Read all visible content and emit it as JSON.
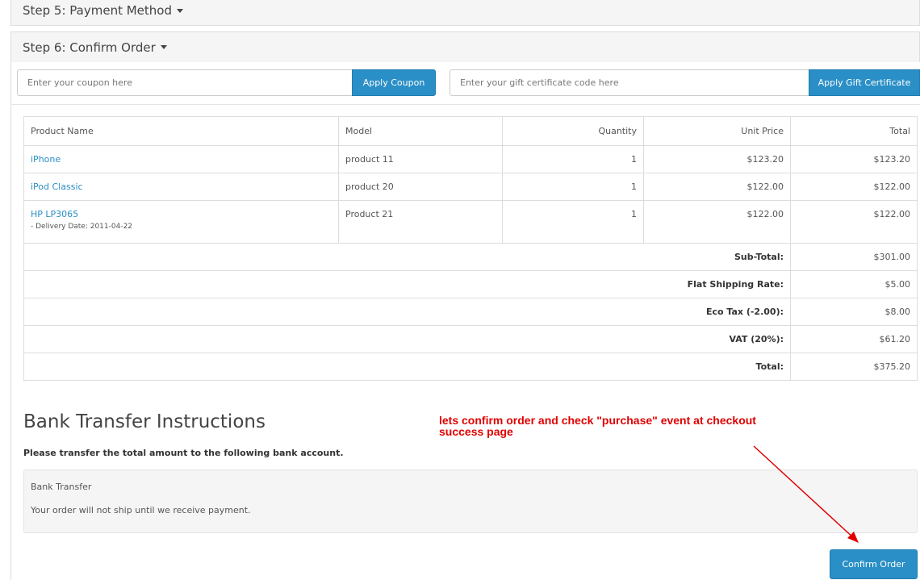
{
  "steps": {
    "step5": "Step 5: Payment Method",
    "step6": "Step 6: Confirm Order"
  },
  "coupon": {
    "placeholder": "Enter your coupon here",
    "button": "Apply Coupon"
  },
  "voucher": {
    "placeholder": "Enter your gift certificate code here",
    "button": "Apply Gift Certificate"
  },
  "table": {
    "headers": [
      "Product Name",
      "Model",
      "Quantity",
      "Unit Price",
      "Total"
    ],
    "rows": [
      {
        "name": "iPhone",
        "model": "product 11",
        "qty": "1",
        "price": "$123.20",
        "total": "$123.20"
      },
      {
        "name": "iPod Classic",
        "model": "product 20",
        "qty": "1",
        "price": "$122.00",
        "total": "$122.00"
      },
      {
        "name": "HP LP3065",
        "option": "- Delivery Date: 2011-04-22",
        "model": "Product 21",
        "qty": "1",
        "price": "$122.00",
        "total": "$122.00"
      }
    ],
    "totals": [
      {
        "label": "Sub-Total:",
        "value": "$301.00"
      },
      {
        "label": "Flat Shipping Rate:",
        "value": "$5.00"
      },
      {
        "label": "Eco Tax (-2.00):",
        "value": "$8.00"
      },
      {
        "label": "VAT (20%):",
        "value": "$61.20"
      },
      {
        "label": "Total:",
        "value": "$375.20"
      }
    ]
  },
  "bank": {
    "title": "Bank Transfer Instructions",
    "subtitle": "Please transfer the total amount to the following bank account.",
    "method": "Bank Transfer",
    "note": "Your order will not ship until we receive payment."
  },
  "annotation": "lets confirm order and check \"purchase\" event at checkout success page",
  "confirm_button": "Confirm Order",
  "colors": {
    "accent": "#2a8fc6",
    "annotation": "#e00000"
  }
}
